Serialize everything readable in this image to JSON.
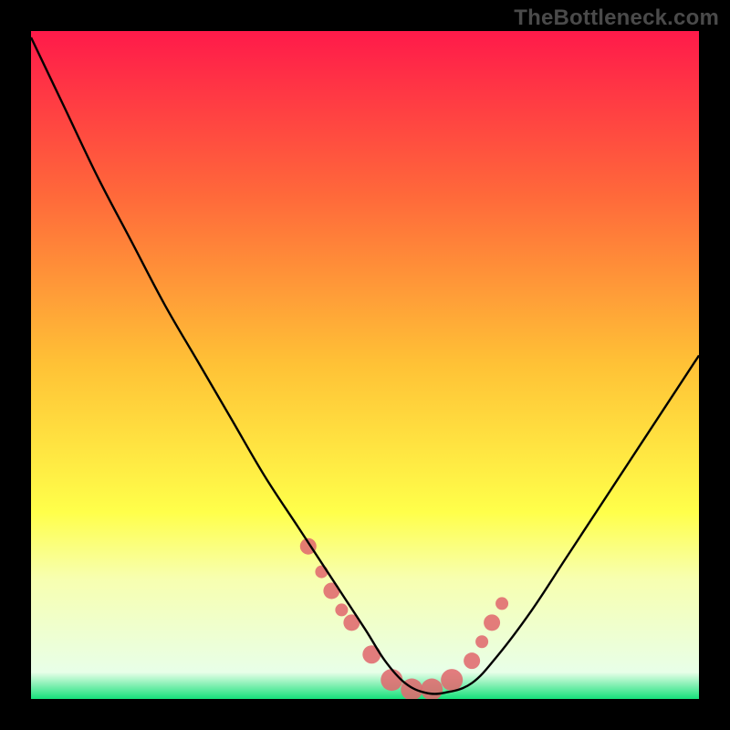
{
  "watermark": "TheBottleneck.com",
  "chart_data": {
    "type": "line",
    "title": "",
    "xlabel": "",
    "ylabel": "",
    "xlim": [
      0,
      100
    ],
    "ylim": [
      0,
      100
    ],
    "background_gradient": {
      "stops": [
        {
          "offset": 0,
          "color": "#ff1a4a"
        },
        {
          "offset": 25,
          "color": "#ff6a3a"
        },
        {
          "offset": 50,
          "color": "#ffc236"
        },
        {
          "offset": 72,
          "color": "#ffff4a"
        },
        {
          "offset": 82,
          "color": "#f7ffb0"
        },
        {
          "offset": 96,
          "color": "#e8ffe8"
        },
        {
          "offset": 100,
          "color": "#15e07a"
        }
      ]
    },
    "series": [
      {
        "name": "bottleneck-curve",
        "type": "line",
        "color": "#000000",
        "x": [
          0,
          5,
          10,
          15,
          20,
          25,
          30,
          35,
          40,
          45,
          50,
          53,
          56,
          59,
          62,
          66,
          70,
          75,
          80,
          85,
          90,
          95,
          100
        ],
        "y": [
          104,
          93,
          82,
          72,
          62,
          53,
          44,
          35,
          27,
          19,
          11,
          6,
          2.5,
          1,
          1,
          2.5,
          7,
          14,
          22,
          30,
          38,
          46,
          54
        ]
      },
      {
        "name": "highlight-dots",
        "type": "scatter",
        "color": "#e06a6e",
        "radius_pattern": "mixed",
        "x": [
          41.5,
          43.5,
          45,
          46.5,
          48,
          51,
          54,
          57,
          60,
          63,
          66,
          67.5,
          69,
          70.5
        ],
        "y": [
          24,
          20,
          17,
          14,
          12,
          7,
          3,
          1.5,
          1.5,
          3,
          6,
          9,
          12,
          15
        ]
      }
    ],
    "lower_band": {
      "color_top": "#f9ffd6",
      "color_mid": "#ecffe4",
      "color_bottom": "#17e07f",
      "y_start": 78,
      "y_end": 100
    }
  }
}
